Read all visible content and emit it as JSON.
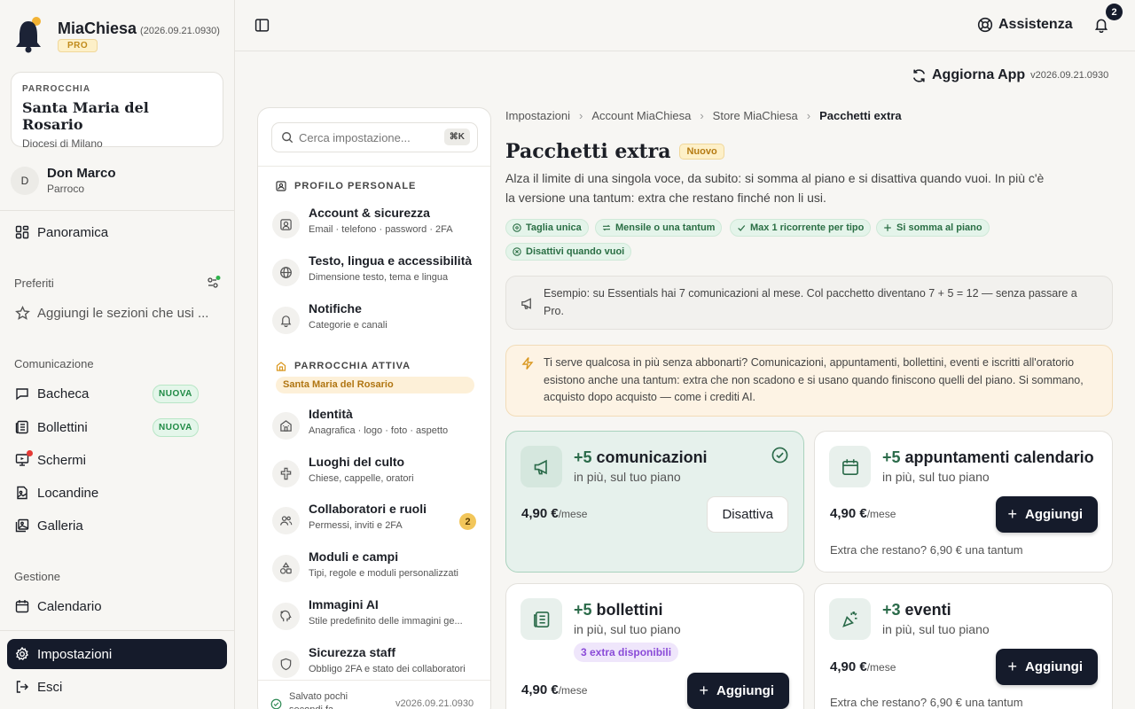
{
  "app": {
    "name": "MiaChiesa",
    "version": "(2026.09.21.0930)",
    "plan": "PRO"
  },
  "parish": {
    "label": "PARROCCHIA",
    "name": "Santa Maria del Rosario",
    "diocese": "Diocesi di Milano"
  },
  "user": {
    "initial": "D",
    "name": "Don Marco",
    "role": "Parroco"
  },
  "sidebar": {
    "overview": "Panoramica",
    "favorites_title": "Preferiti",
    "favorites_hint": "Aggiungi le sezioni che usi ...",
    "communication_title": "Comunicazione",
    "communication": [
      {
        "label": "Bacheca",
        "badge": "NUOVA"
      },
      {
        "label": "Bollettini",
        "badge": "NUOVA"
      },
      {
        "label": "Schermi"
      },
      {
        "label": "Locandine"
      },
      {
        "label": "Galleria"
      }
    ],
    "management_title": "Gestione",
    "management": [
      {
        "label": "Calendario"
      }
    ],
    "settings": "Impostazioni",
    "logout": "Esci"
  },
  "topbar": {
    "help": "Assistenza",
    "notifications_count": "2",
    "update": "Aggiorna App",
    "update_version": "v2026.09.21.0930"
  },
  "settings_panel": {
    "search_placeholder": "Cerca impostazione...",
    "shortcut": "⌘K",
    "personal_group": "PROFILO PERSONALE",
    "personal": [
      {
        "title": "Account & sicurezza",
        "sub": "Email · telefono · password · 2FA"
      },
      {
        "title": "Testo, lingua e accessibilità",
        "sub": "Dimensione testo, tema e lingua"
      },
      {
        "title": "Notifiche",
        "sub": "Categorie e canali"
      }
    ],
    "parish_group": "PARROCCHIA ATTIVA",
    "active_parish": "Santa Maria del Rosario",
    "parish_items": [
      {
        "title": "Identità",
        "sub": "Anagrafica · logo · foto · aspetto"
      },
      {
        "title": "Luoghi del culto",
        "sub": "Chiese, cappelle, oratori"
      },
      {
        "title": "Collaboratori e ruoli",
        "sub": "Permessi, inviti e 2FA",
        "count": "2"
      },
      {
        "title": "Moduli e campi",
        "sub": "Tipi, regole e moduli personalizzati"
      },
      {
        "title": "Immagini AI",
        "sub": "Stile predefinito delle immagini ge..."
      },
      {
        "title": "Sicurezza staff",
        "sub": "Obbligo 2FA e stato dei collaboratori"
      }
    ],
    "saved": "Salvato pochi secondi fa",
    "version": "v2026.09.21.0930"
  },
  "main": {
    "breadcrumb": [
      "Impostazioni",
      "Account MiaChiesa",
      "Store MiaChiesa",
      "Pacchetti extra"
    ],
    "title": "Pacchetti extra",
    "title_badge": "Nuovo",
    "description": "Alza il limite di una singola voce, da subito: si somma al piano e si disattiva quando vuoi. In più c'è la versione una tantum: extra che restano finché non li usi.",
    "chips": [
      "Taglia unica",
      "Mensile o una tantum",
      "Max 1 ricorrente per tipo",
      "Si somma al piano",
      "Disattivi quando vuoi"
    ],
    "example_note": "Esempio: su Essentials hai 7 comunicazioni al mese. Col pacchetto diventano 7 + 5 = 12 — senza passare a Pro.",
    "tip_note": "Ti serve qualcosa in più senza abbonarti? Comunicazioni, appuntamenti, bollettini, eventi e iscritti all'oratorio esistono anche una tantum: extra che non scadono e si usano quando finiscono quelli del piano. Si sommano, acquisto dopo acquisto — come i crediti AI.",
    "packs": [
      {
        "amount": "+5",
        "name": "comunicazioni",
        "sub": "in più, sul tuo piano",
        "price": "4,90 €",
        "unit": "/mese",
        "action": "Disattiva",
        "active": true
      },
      {
        "amount": "+5",
        "name": "appuntamenti calendario",
        "sub": "in più, sul tuo piano",
        "price": "4,90 €",
        "unit": "/mese",
        "action": "Aggiungi",
        "extra": "Extra che restano? 6,90 € una tantum"
      },
      {
        "amount": "+5",
        "name": "bollettini",
        "sub": "in più, sul tuo piano",
        "price": "4,90 €",
        "unit": "/mese",
        "action": "Aggiungi",
        "pill": "3 extra disponibili"
      },
      {
        "amount": "+3",
        "name": "eventi",
        "sub": "in più, sul tuo piano",
        "price": "4,90 €",
        "unit": "/mese",
        "action": "Aggiungi",
        "extra": "Extra che restano? 6,90 € una tantum"
      }
    ]
  },
  "colors": {
    "accent_dark": "#151b2b",
    "green": "#2b6b4a",
    "badge_amber": "#b57b12",
    "purple": "#8a4bd8"
  }
}
